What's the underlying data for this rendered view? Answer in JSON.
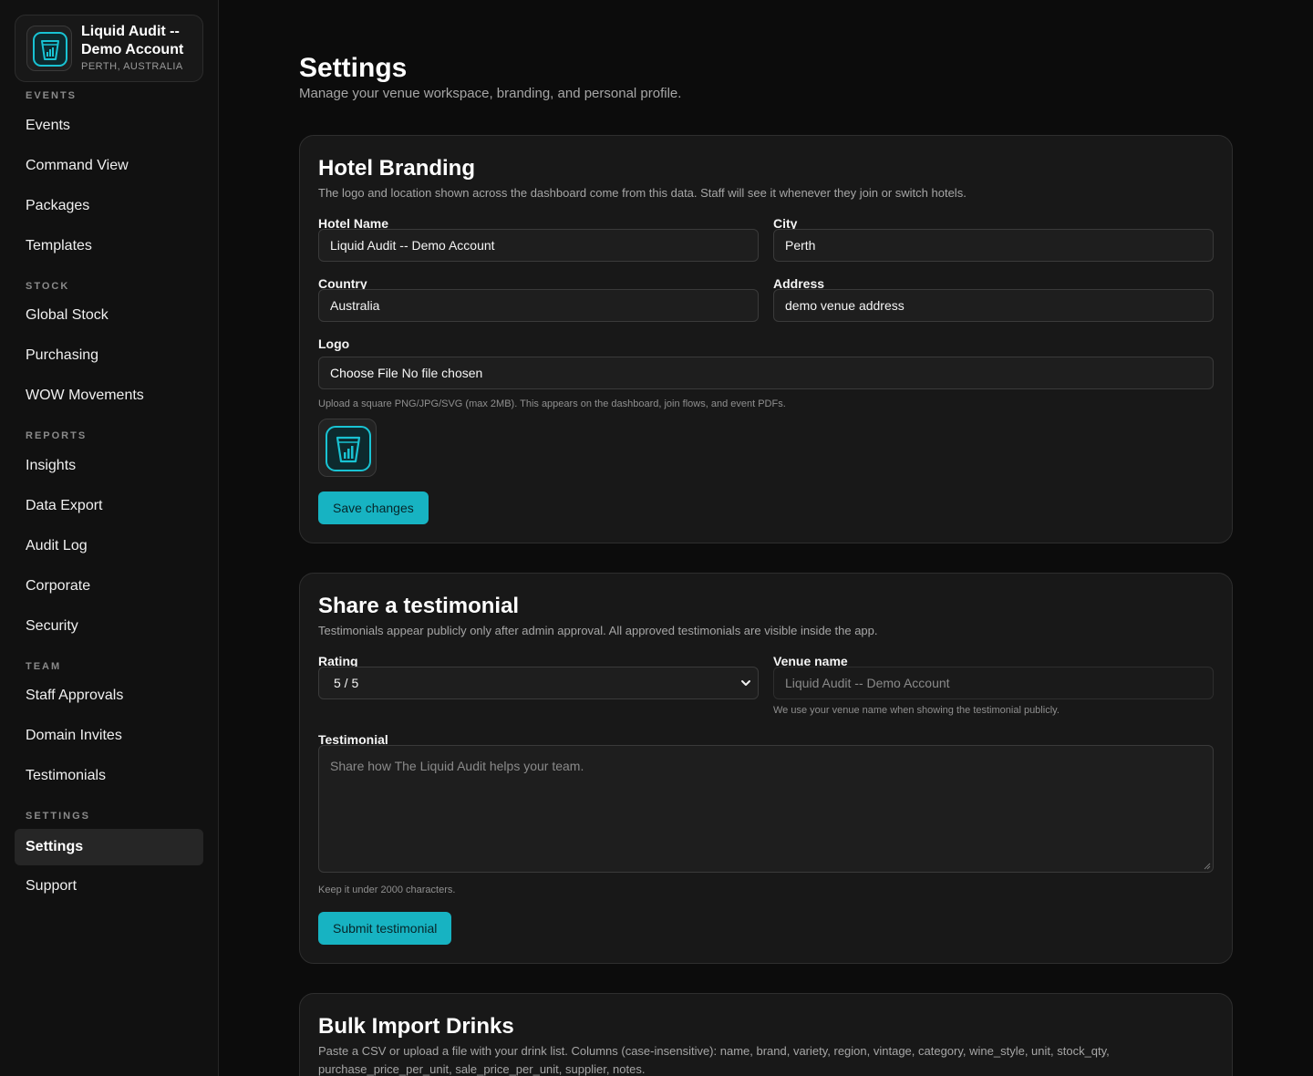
{
  "sidebar": {
    "brand": {
      "name": "Liquid Audit -- Demo Account",
      "location": "PERTH, AUSTRALIA",
      "logo_icon": "glass-chart-icon"
    },
    "sections": [
      {
        "title": "EVENTS",
        "items": [
          "Events",
          "Command View",
          "Packages",
          "Templates"
        ]
      },
      {
        "title": "STOCK",
        "items": [
          "Global Stock",
          "Purchasing",
          "WOW Movements"
        ]
      },
      {
        "title": "REPORTS",
        "items": [
          "Insights",
          "Data Export",
          "Audit Log",
          "Corporate",
          "Security"
        ]
      },
      {
        "title": "TEAM",
        "items": [
          "Staff Approvals",
          "Domain Invites",
          "Testimonials"
        ]
      },
      {
        "title": "SETTINGS",
        "items": [
          "Settings",
          "Support"
        ]
      }
    ],
    "active_item": "Settings"
  },
  "page": {
    "title": "Settings",
    "subtitle": "Manage your venue workspace, branding, and personal profile."
  },
  "branding": {
    "title": "Hotel Branding",
    "description": "The logo and location shown across the dashboard come from this data. Staff will see it whenever they join or switch hotels.",
    "hotel_name_label": "Hotel Name",
    "hotel_name_value": "Liquid Audit -- Demo Account",
    "city_label": "City",
    "city_value": "Perth",
    "country_label": "Country",
    "country_value": "Australia",
    "address_label": "Address",
    "address_value": "demo venue address",
    "logo_label": "Logo",
    "choose_file": "Choose File",
    "no_file": "No file chosen",
    "logo_hint": "Upload a square PNG/JPG/SVG (max 2MB). This appears on the dashboard, join flows, and event PDFs.",
    "save_label": "Save changes"
  },
  "testimonial": {
    "title": "Share a testimonial",
    "description": "Testimonials appear publicly only after admin approval. All approved testimonials are visible inside the app.",
    "rating_label": "Rating",
    "rating_value": "5 / 5",
    "venue_label": "Venue name",
    "venue_placeholder": "Liquid Audit -- Demo Account",
    "venue_hint": "We use your venue name when showing the testimonial publicly.",
    "text_label": "Testimonial",
    "text_placeholder": "Share how The Liquid Audit helps your team.",
    "text_hint": "Keep it under 2000 characters.",
    "submit_label": "Submit testimonial"
  },
  "bulk_import": {
    "title": "Bulk Import Drinks",
    "description_line1": "Paste a CSV or upload a file with your drink list. Columns (case-insensitive): name, brand, variety, region, vintage, category, wine_style, unit, stock_qty,",
    "description_line2": "purchase_price_per_unit, sale_price_per_unit, supplier, notes."
  },
  "colors": {
    "accent": "#17b3c2",
    "background": "#0c0c0c",
    "card": "#181818"
  }
}
